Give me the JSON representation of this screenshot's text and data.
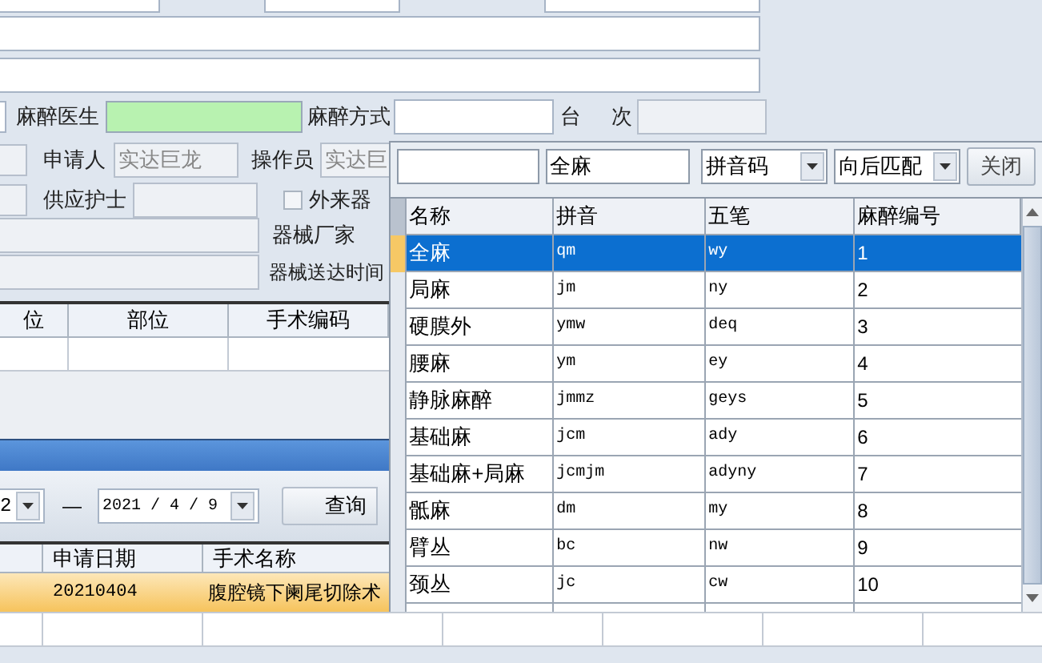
{
  "form": {
    "anesthesia_doctor_label": "麻醉医生",
    "anesthesia_method_label": "麻醉方式",
    "table_label_1": "台",
    "table_label_2": "次",
    "applicant_label": "申请人",
    "applicant_value": "实达巨龙",
    "operator_label": "操作员",
    "operator_value": "实达巨",
    "supply_nurse_label": "供应护士",
    "external_instruments": {
      "label": "外来器",
      "checked": false
    },
    "instrument_vendor_label": "器械厂家",
    "instrument_delivery_label": "器械送达时间"
  },
  "site_table": {
    "columns": [
      "位",
      "部位",
      "手术编码"
    ]
  },
  "query": {
    "date_from": "2",
    "dash": "—",
    "date_to": "2021 / 4 / 9",
    "button": "查询"
  },
  "applications": {
    "columns": [
      "申请日期",
      "手术名称"
    ],
    "rows": [
      {
        "date": "20210404",
        "name": "腹腔镜下阑尾切除术",
        "selected": true
      }
    ]
  },
  "picker": {
    "search_value": "全麻",
    "field": "拼音码",
    "match": "向后匹配",
    "close": "关闭",
    "columns": [
      "名称",
      "拼音",
      "五笔",
      "麻醉编号"
    ],
    "rows": [
      {
        "name": "全麻",
        "pinyin": "qm",
        "wubi": "wy",
        "code": "1",
        "selected": true
      },
      {
        "name": "局麻",
        "pinyin": "jm",
        "wubi": "ny",
        "code": "2",
        "selected": false
      },
      {
        "name": "硬膜外",
        "pinyin": "ymw",
        "wubi": "deq",
        "code": "3",
        "selected": false
      },
      {
        "name": "腰麻",
        "pinyin": "ym",
        "wubi": "ey",
        "code": "4",
        "selected": false
      },
      {
        "name": "静脉麻醉",
        "pinyin": "jmmz",
        "wubi": "geys",
        "code": "5",
        "selected": false
      },
      {
        "name": "基础麻",
        "pinyin": "jcm",
        "wubi": "ady",
        "code": "6",
        "selected": false
      },
      {
        "name": "基础麻+局麻",
        "pinyin": "jcmjm",
        "wubi": "adyny",
        "code": "7",
        "selected": false
      },
      {
        "name": "骶麻",
        "pinyin": "dm",
        "wubi": "my",
        "code": "8",
        "selected": false
      },
      {
        "name": "臂丛",
        "pinyin": "bc",
        "wubi": "nw",
        "code": "9",
        "selected": false
      },
      {
        "name": "颈丛",
        "pinyin": "jc",
        "wubi": "cw",
        "code": "10",
        "selected": false
      }
    ]
  }
}
